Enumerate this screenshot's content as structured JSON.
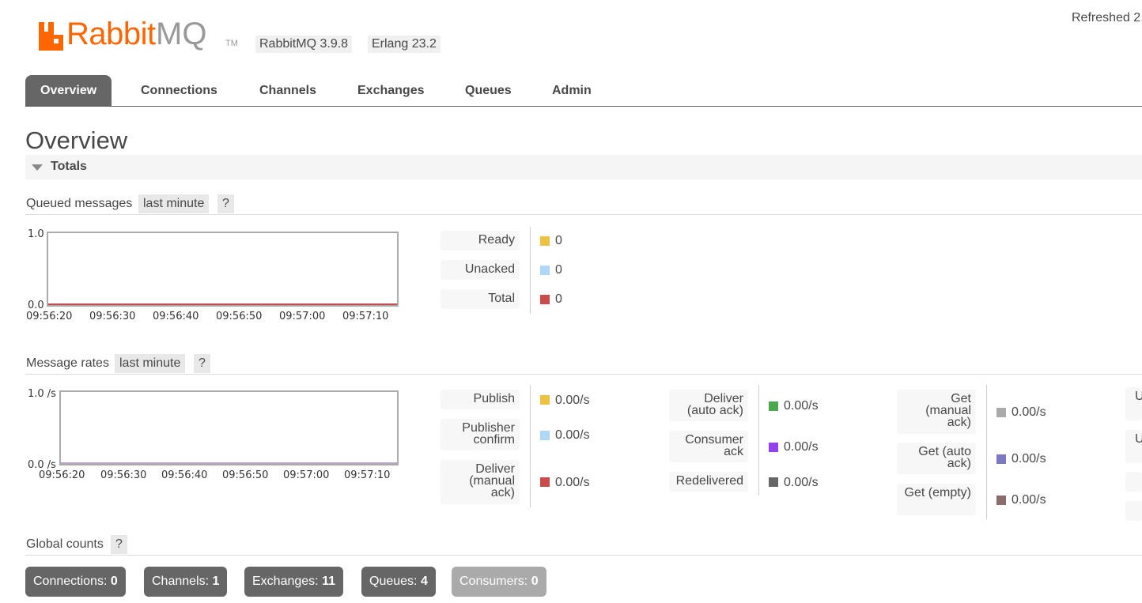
{
  "header": {
    "brand_logo_text": "RabbitMQ",
    "brand_tm": "TM",
    "version_tag": "RabbitMQ 3.9.8",
    "erlang_tag": "Erlang 23.2",
    "refreshed_text": "Refreshed 2"
  },
  "nav": {
    "tabs": [
      {
        "label": "Overview"
      },
      {
        "label": "Connections"
      },
      {
        "label": "Channels"
      },
      {
        "label": "Exchanges"
      },
      {
        "label": "Queues"
      },
      {
        "label": "Admin"
      }
    ]
  },
  "page": {
    "title": "Overview",
    "totals_label": "Totals"
  },
  "queued": {
    "title": "Queued messages",
    "range_pill": "last minute",
    "help": "?",
    "y_top": "1.0",
    "y_bottom": "0.0",
    "x_ticks": [
      "09:56:20",
      "09:56:30",
      "09:56:40",
      "09:56:50",
      "09:57:00",
      "09:57:10"
    ],
    "legend": [
      {
        "label": "Ready",
        "value": "0",
        "color": "#edc240"
      },
      {
        "label": "Unacked",
        "value": "0",
        "color": "#afd8f8"
      },
      {
        "label": "Total",
        "value": "0",
        "color": "#cb4b4b"
      }
    ]
  },
  "rates": {
    "title": "Message rates",
    "range_pill": "last minute",
    "help": "?",
    "y_top": "1.0 /s",
    "y_bottom": "0.0 /s",
    "x_ticks": [
      "09:56:20",
      "09:56:30",
      "09:56:40",
      "09:56:50",
      "09:57:00",
      "09:57:10"
    ],
    "col1": [
      {
        "label": "Publish",
        "value": "0.00/s",
        "color": "#edc240"
      },
      {
        "label": "Publisher confirm",
        "value": "0.00/s",
        "color": "#afd8f8"
      },
      {
        "label": "Deliver (manual ack)",
        "value": "0.00/s",
        "color": "#cb4b4b"
      }
    ],
    "col2": [
      {
        "label": "Deliver (auto ack)",
        "value": "0.00/s",
        "color": "#4da74d"
      },
      {
        "label": "Consumer ack",
        "value": "0.00/s",
        "color": "#9440ed"
      },
      {
        "label": "Redelivered",
        "value": "0.00/s",
        "color": "#666666"
      }
    ],
    "col3": [
      {
        "label": "Get (manual ack)",
        "value": "0.00/s",
        "color": "#aaaaaa"
      },
      {
        "label": "Get (auto ack)",
        "value": "0.00/s",
        "color": "#7c79c3"
      },
      {
        "label": "Get (empty)",
        "value": "0.00/s",
        "color": "#8d6c6c"
      }
    ],
    "col4_partial": [
      "U",
      "U"
    ]
  },
  "global_counts": {
    "title": "Global counts",
    "help": "?",
    "items": [
      {
        "label": "Connections:",
        "value": "0"
      },
      {
        "label": "Channels:",
        "value": "1"
      },
      {
        "label": "Exchanges:",
        "value": "11"
      },
      {
        "label": "Queues:",
        "value": "4"
      },
      {
        "label": "Consumers:",
        "value": "0"
      }
    ]
  },
  "colors": {
    "brand_orange": "#f60",
    "tab_active_bg": "#666666",
    "count_button_bg": "#666666",
    "count_button_dim_bg": "#aaaaaa"
  }
}
